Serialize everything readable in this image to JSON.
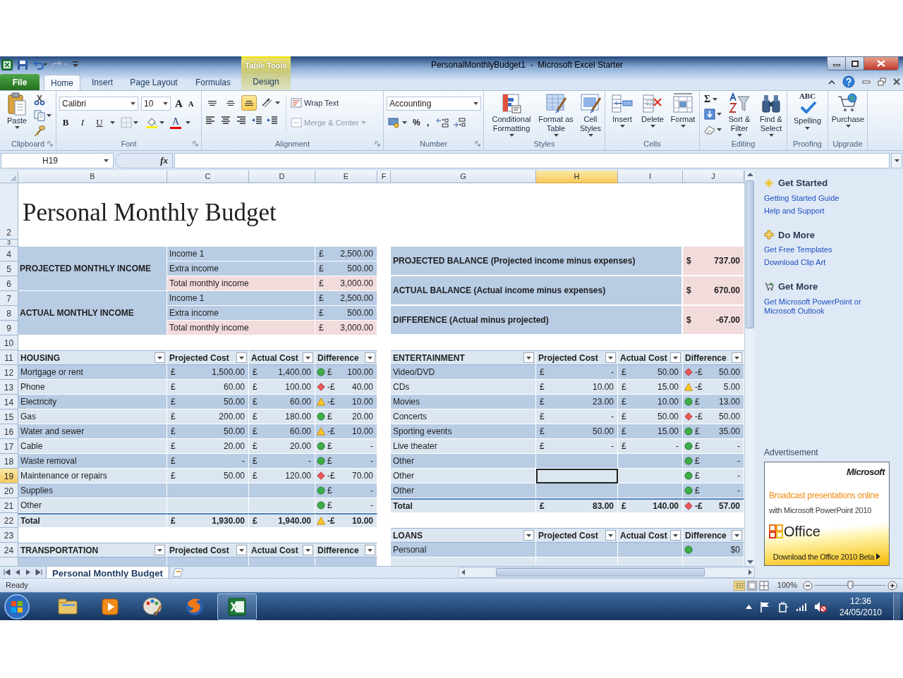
{
  "title_bar": {
    "title": "PersonalMonthlyBudget1  -  Microsoft Excel Starter",
    "contextual_tab": "Table Tools"
  },
  "tabs": [
    {
      "label": "File",
      "kind": "file",
      "selected": false
    },
    {
      "label": "Home",
      "kind": "tab",
      "selected": true
    },
    {
      "label": "Insert",
      "kind": "tab",
      "selected": false
    },
    {
      "label": "Page Layout",
      "kind": "tab",
      "selected": false
    },
    {
      "label": "Formulas",
      "kind": "tab",
      "selected": false
    },
    {
      "label": "Design",
      "kind": "contextual",
      "selected": false
    }
  ],
  "ribbon": {
    "clipboard": {
      "label": "Clipboard",
      "paste": "Paste"
    },
    "font": {
      "label": "Font",
      "font_name": "Calibri",
      "font_size": "10",
      "grow": "A",
      "shrink": "A",
      "bold": "B",
      "italic": "I",
      "underline": "U",
      "font_color": "A"
    },
    "alignment": {
      "label": "Alignment",
      "vertical": [
        {
          "selected": false
        },
        {
          "selected": false
        },
        {
          "selected": true
        }
      ],
      "wrap_text": "Wrap Text",
      "merge": {
        "label": "Merge & Center",
        "disabled": true
      }
    },
    "number": {
      "label": "Number",
      "format": "Accounting",
      "percent": "%",
      "comma": ","
    },
    "styles": {
      "label": "Styles",
      "buttons": [
        "Conditional Formatting",
        "Format as Table",
        "Cell Styles"
      ]
    },
    "cells": {
      "label": "Cells",
      "buttons": [
        "Insert",
        "Delete",
        "Format"
      ]
    },
    "editing": {
      "label": "Editing",
      "sum": "Σ",
      "buttons": [
        "Sort & Filter",
        "Find & Select"
      ]
    },
    "proofing": {
      "label": "Proofing",
      "buttons": [
        "Spelling"
      ],
      "glyph": "ABC"
    },
    "upgrade": {
      "label": "Upgrade",
      "buttons": [
        "Purchase"
      ]
    }
  },
  "formula_bar": {
    "name_box": "H19",
    "function_label": "fx"
  },
  "columns": [
    {
      "label": "B",
      "selected": false
    },
    {
      "label": "C",
      "selected": false
    },
    {
      "label": "D",
      "selected": false
    },
    {
      "label": "E",
      "selected": false
    },
    {
      "label": "F",
      "selected": false
    },
    {
      "label": "G",
      "selected": false
    },
    {
      "label": "H",
      "selected": true
    },
    {
      "label": "I",
      "selected": false
    },
    {
      "label": "J",
      "selected": false
    }
  ],
  "row_headers": [
    {
      "label": "2",
      "selected": false
    },
    {
      "label": "3",
      "selected": false
    },
    {
      "label": "4",
      "selected": false
    },
    {
      "label": "5",
      "selected": false
    },
    {
      "label": "6",
      "selected": false
    },
    {
      "label": "7",
      "selected": false
    },
    {
      "label": "8",
      "selected": false
    },
    {
      "label": "9",
      "selected": false
    },
    {
      "label": "10",
      "selected": false
    },
    {
      "label": "11",
      "selected": false
    },
    {
      "label": "12",
      "selected": false
    },
    {
      "label": "13",
      "selected": false
    },
    {
      "label": "14",
      "selected": false
    },
    {
      "label": "15",
      "selected": false
    },
    {
      "label": "16",
      "selected": false
    },
    {
      "label": "17",
      "selected": false
    },
    {
      "label": "18",
      "selected": false
    },
    {
      "label": "19",
      "selected": true
    },
    {
      "label": "20",
      "selected": false
    },
    {
      "label": "21",
      "selected": false
    },
    {
      "label": "22",
      "selected": false
    },
    {
      "label": "23",
      "selected": false
    },
    {
      "label": "24",
      "selected": false
    }
  ],
  "sheet_title": "Personal Monthly Budget",
  "income": [
    {
      "label": "PROJECTED MONTHLY INCOME",
      "items": [
        {
          "label": "Income 1",
          "currency": "£",
          "amount": "2,500.00",
          "total": false
        },
        {
          "label": "Extra income",
          "currency": "£",
          "amount": "500.00",
          "total": false
        },
        {
          "label": "Total monthly income",
          "currency": "£",
          "amount": "3,000.00",
          "total": true
        }
      ]
    },
    {
      "label": "ACTUAL MONTHLY INCOME",
      "items": [
        {
          "label": "Income 1",
          "currency": "£",
          "amount": "2,500.00",
          "total": false
        },
        {
          "label": "Extra income",
          "currency": "£",
          "amount": "500.00",
          "total": false
        },
        {
          "label": "Total monthly income",
          "currency": "£",
          "amount": "3,000.00",
          "total": true
        }
      ]
    }
  ],
  "balances": [
    {
      "label": "PROJECTED BALANCE (Projected income minus expenses)",
      "currency": "$",
      "amount": "737.00"
    },
    {
      "label": "ACTUAL BALANCE (Actual income minus expenses)",
      "currency": "$",
      "amount": "670.00"
    },
    {
      "label": "DIFFERENCE (Actual minus projected)",
      "currency": "$",
      "amount": "-67.00"
    }
  ],
  "housing": {
    "title": "HOUSING",
    "columns": [
      "Projected Cost",
      "Actual Cost",
      "Difference"
    ],
    "rows": [
      {
        "label": "Mortgage or rent",
        "projected": {
          "currency": "£",
          "amount": "1,500.00"
        },
        "actual": {
          "currency": "£",
          "amount": "1,400.00"
        },
        "difference": {
          "kind": "good",
          "currency": "£",
          "amount": "100.00"
        }
      },
      {
        "label": "Phone",
        "projected": {
          "currency": "£",
          "amount": "60.00"
        },
        "actual": {
          "currency": "£",
          "amount": "100.00"
        },
        "difference": {
          "kind": "bad",
          "currency": "-£",
          "amount": "40.00"
        }
      },
      {
        "label": "Electricity",
        "projected": {
          "currency": "£",
          "amount": "50.00"
        },
        "actual": {
          "currency": "£",
          "amount": "60.00"
        },
        "difference": {
          "kind": "warning",
          "currency": "-£",
          "amount": "10.00"
        }
      },
      {
        "label": "Gas",
        "projected": {
          "currency": "£",
          "amount": "200.00"
        },
        "actual": {
          "currency": "£",
          "amount": "180.00"
        },
        "difference": {
          "kind": "good",
          "currency": "£",
          "amount": "20.00"
        }
      },
      {
        "label": "Water and sewer",
        "projected": {
          "currency": "£",
          "amount": "50.00"
        },
        "actual": {
          "currency": "£",
          "amount": "60.00"
        },
        "difference": {
          "kind": "warning",
          "currency": "-£",
          "amount": "10.00"
        }
      },
      {
        "label": "Cable",
        "projected": {
          "currency": "£",
          "amount": "20.00"
        },
        "actual": {
          "currency": "£",
          "amount": "20.00"
        },
        "difference": {
          "kind": "good",
          "currency": "£",
          "amount": "-"
        }
      },
      {
        "label": "Waste removal",
        "projected": {
          "currency": "£",
          "amount": "-"
        },
        "actual": {
          "currency": "£",
          "amount": "-"
        },
        "difference": {
          "kind": "good",
          "currency": "£",
          "amount": "-"
        }
      },
      {
        "label": "Maintenance or repairs",
        "projected": {
          "currency": "£",
          "amount": "50.00"
        },
        "actual": {
          "currency": "£",
          "amount": "120.00"
        },
        "difference": {
          "kind": "bad",
          "currency": "-£",
          "amount": "70.00"
        }
      },
      {
        "label": "Supplies",
        "difference": {
          "kind": "good",
          "currency": "£",
          "amount": "-"
        }
      },
      {
        "label": "Other",
        "difference": {
          "kind": "good",
          "currency": "£",
          "amount": "-"
        }
      }
    ],
    "total": {
      "label": "Total",
      "projected": {
        "currency": "£",
        "amount": "1,930.00"
      },
      "actual": {
        "currency": "£",
        "amount": "1,940.00"
      },
      "difference": {
        "kind": "warning",
        "currency": "-£",
        "amount": "10.00"
      }
    }
  },
  "entertainment": {
    "title": "ENTERTAINMENT",
    "columns": [
      "Projected Cost",
      "Actual Cost",
      "Difference"
    ],
    "rows": [
      {
        "label": "Video/DVD",
        "selected": false,
        "projected": {
          "currency": "£",
          "amount": "-"
        },
        "actual": {
          "currency": "£",
          "amount": "50.00"
        },
        "difference": {
          "kind": "bad",
          "currency": "-£",
          "amount": "50.00"
        }
      },
      {
        "label": "CDs",
        "selected": false,
        "projected": {
          "currency": "£",
          "amount": "10.00"
        },
        "actual": {
          "currency": "£",
          "amount": "15.00"
        },
        "difference": {
          "kind": "warning",
          "currency": "-£",
          "amount": "5.00"
        }
      },
      {
        "label": "Movies",
        "selected": false,
        "projected": {
          "currency": "£",
          "amount": "23.00"
        },
        "actual": {
          "currency": "£",
          "amount": "10.00"
        },
        "difference": {
          "kind": "good",
          "currency": "£",
          "amount": "13.00"
        }
      },
      {
        "label": "Concerts",
        "selected": false,
        "projected": {
          "currency": "£",
          "amount": "-"
        },
        "actual": {
          "currency": "£",
          "amount": "50.00"
        },
        "difference": {
          "kind": "bad",
          "currency": "-£",
          "amount": "50.00"
        }
      },
      {
        "label": "Sporting events",
        "selected": false,
        "projected": {
          "currency": "£",
          "amount": "50.00"
        },
        "actual": {
          "currency": "£",
          "amount": "15.00"
        },
        "difference": {
          "kind": "good",
          "currency": "£",
          "amount": "35.00"
        }
      },
      {
        "label": "Live theater",
        "selected": false,
        "projected": {
          "currency": "£",
          "amount": "-"
        },
        "actual": {
          "currency": "£",
          "amount": "-"
        },
        "difference": {
          "kind": "good",
          "currency": "£",
          "amount": "-"
        }
      },
      {
        "label": "Other",
        "selected": false,
        "difference": {
          "kind": "good",
          "currency": "£",
          "amount": "-"
        }
      },
      {
        "label": "Other",
        "selected": true,
        "difference": {
          "kind": "good",
          "currency": "£",
          "amount": "-"
        }
      },
      {
        "label": "Other",
        "selected": false,
        "difference": {
          "kind": "good",
          "currency": "£",
          "amount": "-"
        }
      }
    ],
    "total": {
      "label": "Total",
      "projected": {
        "currency": "£",
        "amount": "83.00"
      },
      "actual": {
        "currency": "£",
        "amount": "140.00"
      },
      "difference": {
        "kind": "bad",
        "currency": "-£",
        "amount": "57.00"
      }
    }
  },
  "loans": {
    "title": "LOANS",
    "columns": [
      "Projected Cost",
      "Actual Cost",
      "Difference"
    ],
    "rows": [
      {
        "label": "Personal",
        "difference": {
          "kind": "good",
          "amount": "$0"
        }
      }
    ]
  },
  "transportation": {
    "title": "TRANSPORTATION",
    "columns": [
      "Projected Cost",
      "Actual Cost",
      "Difference"
    ]
  },
  "sheet_tabs": [
    {
      "label": "Personal Monthly Budget",
      "selected": true
    }
  ],
  "task_pane": {
    "sections": [
      {
        "title": "Get Started",
        "links": [
          "Getting Started Guide",
          "Help and Support"
        ]
      },
      {
        "title": "Do More",
        "links": [
          "Get Free Templates",
          "Download Clip Art"
        ]
      },
      {
        "title": "Get More",
        "links": [
          "Get Microsoft PowerPoint or Microsoft Outlook"
        ]
      }
    ],
    "ad": {
      "label": "Advertisement",
      "brand": "Microsoft",
      "headline": "Broadcast presentations online",
      "subline": "with Microsoft PowerPoint 2010",
      "logo": "Office",
      "cta": "Download the Office 2010 Beta"
    }
  },
  "status_bar": {
    "text": "Ready",
    "zoom": "100%",
    "zoom_slider": {
      "level": 0.5
    }
  },
  "taskbar": {
    "apps": [
      {
        "active": false
      },
      {
        "active": false
      },
      {
        "active": false
      },
      {
        "active": false
      },
      {
        "active": true
      }
    ],
    "time": "12:36",
    "date": "24/05/2010"
  }
}
